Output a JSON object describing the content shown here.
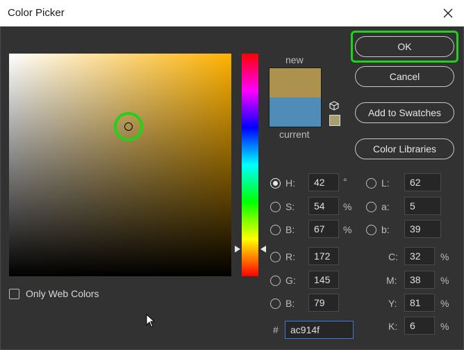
{
  "window": {
    "title": "Color Picker"
  },
  "swatch": {
    "new_label": "new",
    "current_label": "current",
    "new_color": "#ac914f",
    "current_color": "#4f8cb8"
  },
  "buttons": {
    "ok": "OK",
    "cancel": "Cancel",
    "add_to_swatches": "Add to Swatches",
    "color_libraries": "Color Libraries"
  },
  "hsb": {
    "h": {
      "label": "H:",
      "value": "42",
      "unit": "°",
      "checked": true
    },
    "s": {
      "label": "S:",
      "value": "54",
      "unit": "%"
    },
    "b": {
      "label": "B:",
      "value": "67",
      "unit": "%"
    }
  },
  "rgb": {
    "r": {
      "label": "R:",
      "value": "172"
    },
    "g": {
      "label": "G:",
      "value": "145"
    },
    "b": {
      "label": "B:",
      "value": "79"
    }
  },
  "lab": {
    "l": {
      "label": "L:",
      "value": "62"
    },
    "a": {
      "label": "a:",
      "value": "5"
    },
    "b": {
      "label": "b:",
      "value": "39"
    }
  },
  "cmyk": {
    "c": {
      "label": "C:",
      "value": "32",
      "unit": "%"
    },
    "m": {
      "label": "M:",
      "value": "38",
      "unit": "%"
    },
    "y": {
      "label": "Y:",
      "value": "81",
      "unit": "%"
    },
    "k": {
      "label": "K:",
      "value": "6",
      "unit": "%"
    }
  },
  "hex": {
    "label": "#",
    "value": "ac914f"
  },
  "only_web_colors": {
    "label": "Only Web Colors",
    "checked": false
  },
  "colors": {
    "highlight": "#22d11b",
    "field_hue": "#ffb200"
  }
}
